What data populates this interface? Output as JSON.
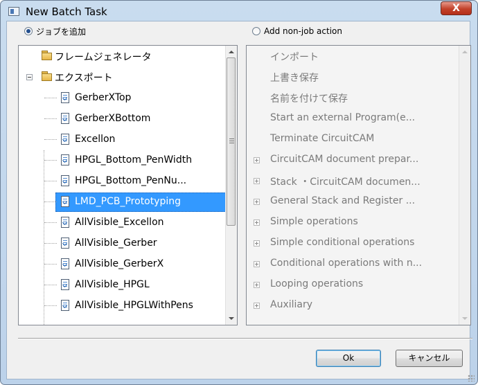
{
  "window": {
    "title": "New Batch Task",
    "close_label": "X"
  },
  "options": {
    "add_job": {
      "label": "ジョブを追加",
      "checked": true
    },
    "add_non_job": {
      "label": "Add non-job action",
      "checked": false
    }
  },
  "jobs_tree": {
    "root_items": [
      {
        "label": "フレームジェネレータ",
        "icon": "folder-icon"
      },
      {
        "label": "エクスポート",
        "icon": "folder-icon",
        "expanded": true
      }
    ],
    "children": [
      {
        "label": "GerberXTop",
        "icon": "document-icon"
      },
      {
        "label": "GerberXBottom",
        "icon": "document-icon"
      },
      {
        "label": "Excellon",
        "icon": "document-icon"
      },
      {
        "label": "HPGL_Bottom_PenWidth",
        "icon": "document-icon"
      },
      {
        "label": "HPGL_Bottom_PenNu...",
        "icon": "document-icon"
      },
      {
        "label": "LMD_PCB_Prototyping",
        "icon": "document-icon",
        "selected": true
      },
      {
        "label": "AllVisible_Excellon",
        "icon": "document-icon"
      },
      {
        "label": "AllVisible_Gerber",
        "icon": "document-icon"
      },
      {
        "label": "AllVisible_GerberX",
        "icon": "document-icon"
      },
      {
        "label": "AllVisible_HPGL",
        "icon": "document-icon"
      },
      {
        "label": "AllVisible_HPGLWithPens",
        "icon": "document-icon"
      }
    ]
  },
  "actions_list": {
    "items": [
      {
        "label": "インポート",
        "expandable": false
      },
      {
        "label": "上書き保存",
        "expandable": false
      },
      {
        "label": "名前を付けて保存",
        "expandable": false
      },
      {
        "label": "Start an external Program(e...",
        "expandable": false
      },
      {
        "label": "Terminate CircuitCAM",
        "expandable": false
      },
      {
        "label": "CircuitCAM document prepar...",
        "expandable": true
      },
      {
        "label": "Stack ・CircuitCAM documen...",
        "expandable": true
      },
      {
        "label": "General Stack and Register ...",
        "expandable": true
      },
      {
        "label": "Simple operations",
        "expandable": true
      },
      {
        "label": "Simple conditional operations",
        "expandable": true
      },
      {
        "label": "Conditional operations with n...",
        "expandable": true
      },
      {
        "label": "Looping operations",
        "expandable": true
      },
      {
        "label": "Auxiliary",
        "expandable": true
      }
    ]
  },
  "buttons": {
    "ok": "Ok",
    "cancel": "キャンセル"
  },
  "colors": {
    "selection": "#3399ff",
    "title_bar": "#c9dcef",
    "close_button": "#c2412a"
  }
}
